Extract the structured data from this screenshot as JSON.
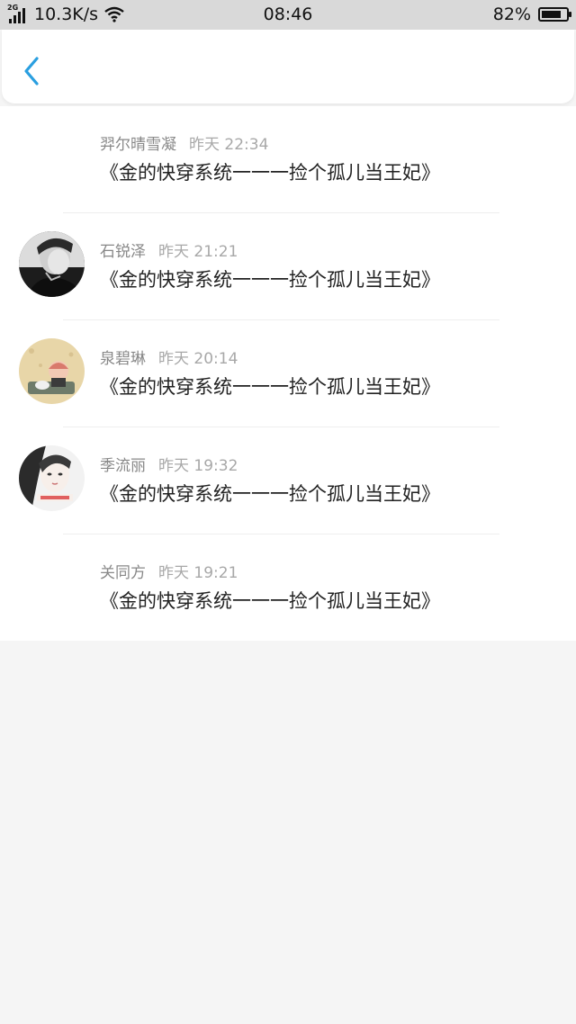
{
  "status_bar": {
    "network_type": "2G",
    "speed": "10.3K/s",
    "time": "08:46",
    "battery_percent": "82%",
    "battery_level": 0.82
  },
  "header": {
    "back_icon": "chevron-left-icon",
    "accent_color": "#2a9fe0"
  },
  "messages": [
    {
      "name": "羿尔晴雪凝",
      "time": "昨天 22:34",
      "text": "《金的快穿系统一一一捡个孤儿当王妃》",
      "has_avatar": false
    },
    {
      "name": "石锐泽",
      "time": "昨天 21:21",
      "text": "《金的快穿系统一一一捡个孤儿当王妃》",
      "has_avatar": true
    },
    {
      "name": "泉碧琳",
      "time": "昨天 20:14",
      "text": "《金的快穿系统一一一捡个孤儿当王妃》",
      "has_avatar": true
    },
    {
      "name": "季流丽",
      "time": "昨天 19:32",
      "text": "《金的快穿系统一一一捡个孤儿当王妃》",
      "has_avatar": true
    },
    {
      "name": "关同方",
      "time": "昨天 19:21",
      "text": "《金的快穿系统一一一捡个孤儿当王妃》",
      "has_avatar": false
    }
  ]
}
